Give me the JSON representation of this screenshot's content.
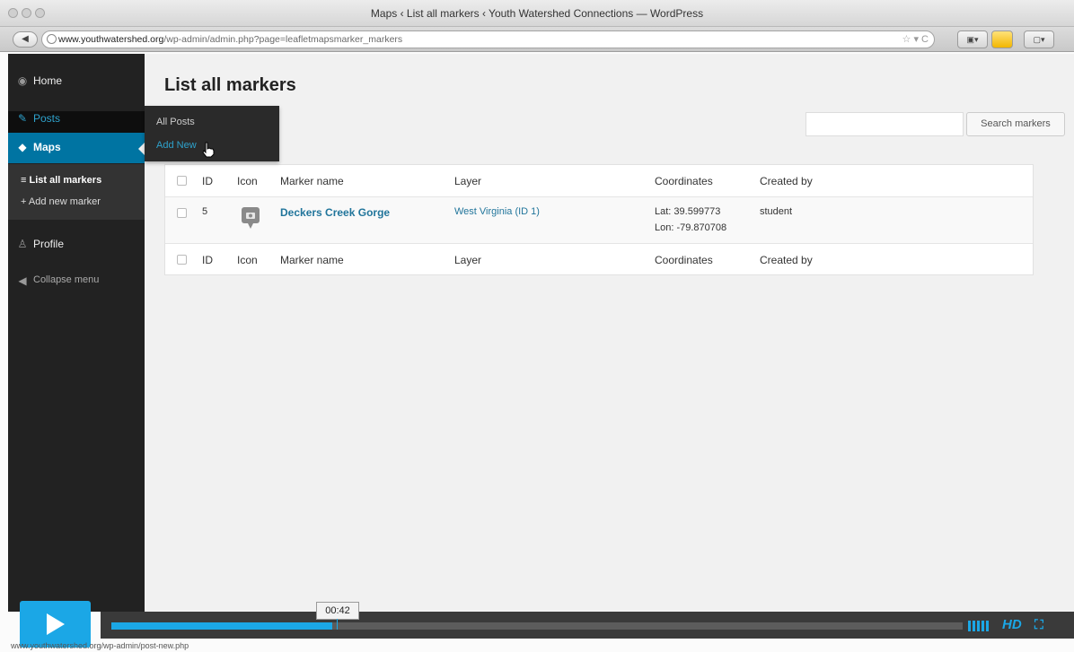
{
  "window": {
    "title": "Maps ‹ List all markers ‹ Youth Watershed Connections — WordPress",
    "url_domain": "www.youthwatershed.org",
    "url_path": "/wp-admin/admin.php?page=leafletmapsmarker_markers"
  },
  "sidebar": {
    "home": "Home",
    "posts": "Posts",
    "maps": "Maps",
    "submenu": [
      "≡ List all markers",
      "+ Add new marker"
    ],
    "profile": "Profile",
    "collapse": "Collapse menu"
  },
  "flyout": {
    "items": [
      "All Posts",
      "Add New"
    ]
  },
  "main": {
    "page_title": "List all markers",
    "search_button": "Search markers",
    "search_placeholder": "",
    "columns": [
      "ID",
      "Icon",
      "Marker name",
      "Layer",
      "Coordinates",
      "Created by"
    ],
    "rows": [
      {
        "id": "5",
        "marker_name": "Deckers Creek Gorge",
        "layer": "West Virginia (ID 1)",
        "lat": "Lat: 39.599773",
        "lon": "Lon: -79.870708",
        "created_by": "student"
      }
    ]
  },
  "player": {
    "time": "00:42",
    "progress": 0.26,
    "hd_label": "HD",
    "status_url": "www.youthwatershed.org/wp-admin/post-new.php"
  },
  "colors": {
    "accent": "#1ba7e6",
    "wp_link": "#21759b",
    "sidebar_bg": "#222222",
    "active_menu": "#0074a2"
  }
}
